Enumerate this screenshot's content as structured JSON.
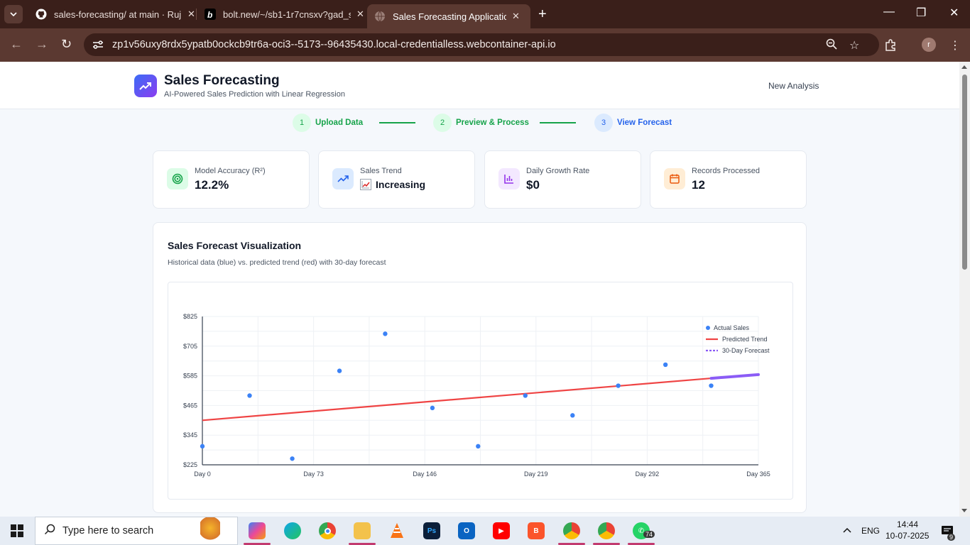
{
  "browser": {
    "tabs": [
      {
        "title": "sales-forecasting/ at main · Ruj",
        "icon": "github-icon"
      },
      {
        "title": "bolt.new/~/sb1-1r7cnsxv?gad_s",
        "icon": "bolt-icon"
      },
      {
        "title": "Sales Forecasting Application w",
        "icon": "globe-icon",
        "active": true
      }
    ],
    "url": "zp1v56uxy8rdx5ypatb0ockcb9tr6a-oci3--5173--96435430.local-credentialless.webcontainer-api.io",
    "profile_initial": "r"
  },
  "app": {
    "title": "Sales Forecasting",
    "subtitle": "AI-Powered Sales Prediction with Linear Regression",
    "new_analysis": "New Analysis"
  },
  "steps": [
    {
      "num": "1",
      "label": "Upload Data",
      "state": "done"
    },
    {
      "num": "2",
      "label": "Preview & Process",
      "state": "done"
    },
    {
      "num": "3",
      "label": "View Forecast",
      "state": "current"
    }
  ],
  "stats": [
    {
      "label": "Model Accuracy (R²)",
      "value": "12.2%",
      "icon": "target-icon",
      "color": "#16a34a",
      "bg": "#dcfce7"
    },
    {
      "label": "Sales Trend",
      "value": "Increasing",
      "icon": "trending-up-icon",
      "color": "#2563eb",
      "bg": "#dbeafe"
    },
    {
      "label": "Daily Growth Rate",
      "value": "$0",
      "icon": "bar-chart-icon",
      "color": "#9333ea",
      "bg": "#f3e8ff"
    },
    {
      "label": "Records Processed",
      "value": "12",
      "icon": "calendar-icon",
      "color": "#ea580c",
      "bg": "#ffedd5"
    }
  ],
  "viz": {
    "title": "Sales Forecast Visualization",
    "subtitle": "Historical data (blue) vs. predicted trend (red) with 30-day forecast"
  },
  "chart_data": {
    "type": "scatter",
    "x_ticks": [
      "Day 0",
      "Day 73",
      "Day 146",
      "Day 219",
      "Day 292",
      "Day 365"
    ],
    "y_ticks": [
      "$825",
      "$705",
      "$585",
      "$465",
      "$345",
      "$225"
    ],
    "xlim": [
      0,
      365
    ],
    "ylim": [
      225,
      825
    ],
    "grid": true,
    "legend_position": "top-right",
    "series": [
      {
        "name": "Actual Sales",
        "color": "#3b82f6",
        "points": [
          [
            0,
            300
          ],
          [
            31,
            505
          ],
          [
            59,
            250
          ],
          [
            90,
            605
          ],
          [
            120,
            755
          ],
          [
            151,
            455
          ],
          [
            181,
            300
          ],
          [
            212,
            505
          ],
          [
            243,
            425
          ],
          [
            273,
            545
          ],
          [
            304,
            630
          ],
          [
            334,
            545
          ]
        ]
      },
      {
        "name": "Predicted Trend",
        "color": "#ef4444",
        "points": [
          [
            0,
            405
          ],
          [
            334,
            575
          ]
        ]
      },
      {
        "name": "30-Day Forecast",
        "color": "#8b5cf6",
        "points": [
          [
            334,
            575
          ],
          [
            365,
            590
          ]
        ]
      }
    ]
  },
  "taskbar": {
    "search_placeholder": "Type here to search",
    "language": "ENG",
    "time": "14:44",
    "date": "10-07-2025",
    "whatsapp_badge": "74",
    "notifications_badge": "9"
  }
}
